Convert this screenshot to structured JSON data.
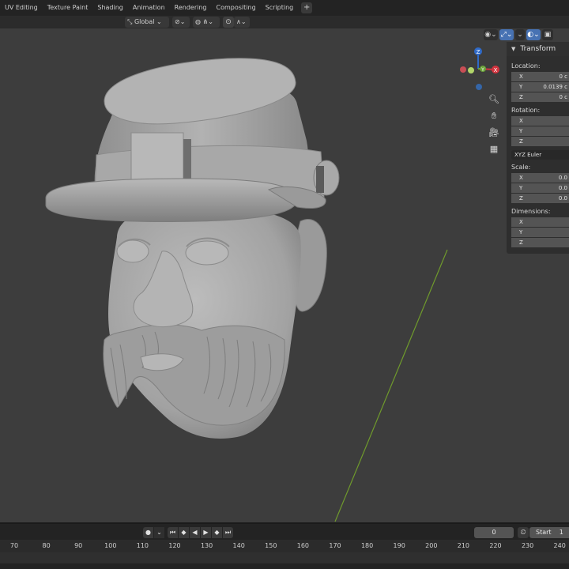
{
  "tabs": [
    "UV Editing",
    "Texture Paint",
    "Shading",
    "Animation",
    "Rendering",
    "Compositing",
    "Scripting"
  ],
  "tab_add": "+",
  "toolbar": {
    "orientation": "Global"
  },
  "gizmo": {
    "z": "Z",
    "y": "Y",
    "x": "X",
    "colors": {
      "x": "#d4343f",
      "y": "#6ba33a",
      "z": "#2f6ac8"
    }
  },
  "npanel": {
    "title": "Transform",
    "location_label": "Location:",
    "location": [
      {
        "axis": "X",
        "value": "0 c"
      },
      {
        "axis": "Y",
        "value": "0.0139 c"
      },
      {
        "axis": "Z",
        "value": "0 c"
      }
    ],
    "rotation_label": "Rotation:",
    "rotation": [
      {
        "axis": "X",
        "value": ""
      },
      {
        "axis": "Y",
        "value": ""
      },
      {
        "axis": "Z",
        "value": ""
      }
    ],
    "rotation_mode": "XYZ Euler",
    "scale_label": "Scale:",
    "scale": [
      {
        "axis": "X",
        "value": "0.0"
      },
      {
        "axis": "Y",
        "value": "0.0"
      },
      {
        "axis": "Z",
        "value": "0.0"
      }
    ],
    "dimensions_label": "Dimensions:",
    "dimensions": [
      {
        "axis": "X",
        "value": ""
      },
      {
        "axis": "Y",
        "value": ""
      },
      {
        "axis": "Z",
        "value": ""
      }
    ]
  },
  "timeline": {
    "current_frame": "0",
    "start_label": "Start",
    "start_value": "1",
    "ticks": [
      "70",
      "80",
      "90",
      "100",
      "110",
      "120",
      "130",
      "140",
      "150",
      "160",
      "170",
      "180",
      "190",
      "200",
      "210",
      "220",
      "230",
      "240"
    ]
  },
  "colors": {
    "viewport_bg": "#3d3d3d",
    "model": "#a7a7a7",
    "accent": "#4772b3",
    "y_axis_line": "#6f9a2c"
  }
}
